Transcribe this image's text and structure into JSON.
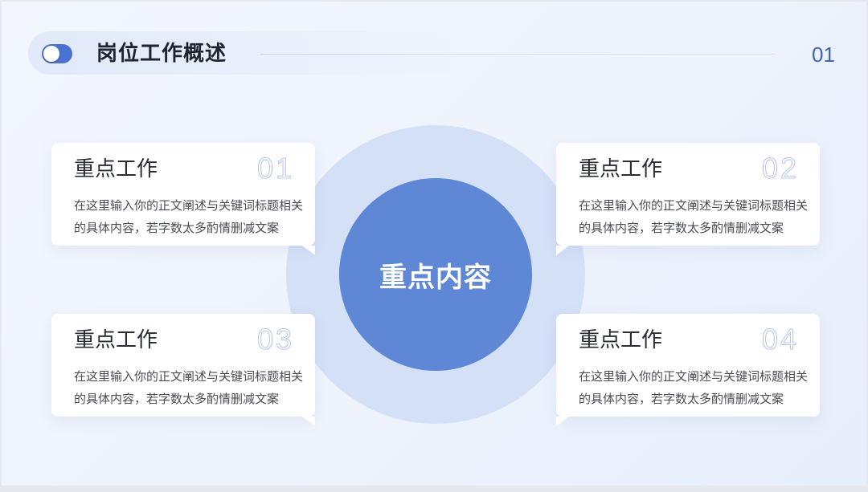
{
  "header": {
    "title": "岗位工作概述",
    "page_number": "01"
  },
  "center": {
    "label": "重点内容"
  },
  "cards": [
    {
      "title": "重点工作",
      "number": "01",
      "body": "在这里输入你的正文阐述与关键词标题相关的具体内容，若字数太多酌情删减文案"
    },
    {
      "title": "重点工作",
      "number": "02",
      "body": "在这里输入你的正文阐述与关键词标题相关的具体内容，若字数太多酌情删减文案"
    },
    {
      "title": "重点工作",
      "number": "03",
      "body": "在这里输入你的正文阐述与关键词标题相关的具体内容，若字数太多酌情删减文案"
    },
    {
      "title": "重点工作",
      "number": "04",
      "body": "在这里输入你的正文阐述与关键词标题相关的具体内容，若字数太多酌情删减文案"
    }
  ],
  "colors": {
    "accent": "#5e88d6",
    "ring": "#d3e0f6",
    "title_text": "#1e2330",
    "page_number": "#3e63c2"
  },
  "icons": {
    "header_toggle": "toggle-switch-icon"
  }
}
